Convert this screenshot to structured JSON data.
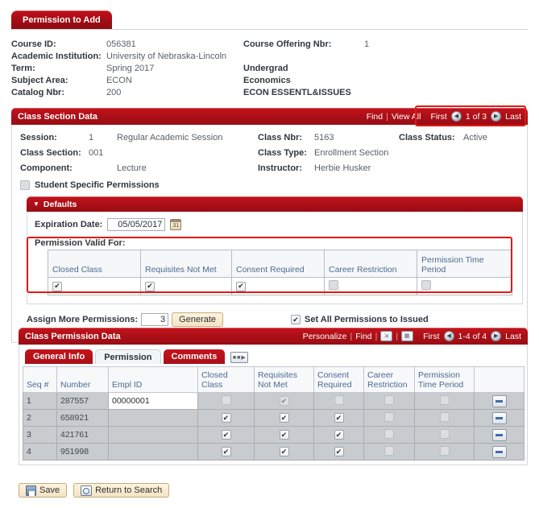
{
  "page_tab": {
    "label": "Permission to Add"
  },
  "header": {
    "rows": [
      {
        "label": "Course ID:",
        "value": "056381",
        "label2": "Course Offering Nbr:",
        "value2": "1"
      },
      {
        "label": "Academic Institution:",
        "value": "University of Nebraska-Lincoln",
        "label2": "",
        "value2": ""
      },
      {
        "label": "Term:",
        "value": "Spring 2017",
        "label2": "",
        "value2": "Undergrad"
      },
      {
        "label": "Subject Area:",
        "value": "ECON",
        "label2": "",
        "value2": "Economics"
      },
      {
        "label": "Catalog Nbr:",
        "value": "200",
        "label2": "",
        "value2": "ECON ESSENTL&ISSUES"
      }
    ]
  },
  "class_section_data": {
    "title": "Class Section Data",
    "find_label": "Find",
    "view_all_label": "View All",
    "first_label": "First",
    "last_label": "Last",
    "counter": "1 of 3",
    "prev_icon": "left-arrow-icon",
    "next_icon": "right-arrow-icon",
    "fields": {
      "session_label": "Session:",
      "session_nbr": "1",
      "session_desc": "Regular Academic Session",
      "class_nbr_label": "Class Nbr:",
      "class_nbr": "5163",
      "class_status_label": "Class Status:",
      "class_status": "Active",
      "class_section_label": "Class Section:",
      "class_section": "001",
      "class_type_label": "Class Type:",
      "class_type": "Enrollment Section",
      "component_label": "Component:",
      "component": "Lecture",
      "instructor_label": "Instructor:",
      "instructor": "Herbie Husker"
    },
    "student_specific": {
      "label": "Student Specific Permissions",
      "checked": false
    }
  },
  "defaults": {
    "title": "Defaults",
    "collapse_icon": "triangle-down-icon",
    "expiration_label": "Expiration Date:",
    "expiration_value": "05/05/2017",
    "calendar_icon": "calendar-icon",
    "permission_valid_for_label": "Permission Valid For:",
    "columns": [
      "Closed Class",
      "Requisites Not Met",
      "Consent Required",
      "Career Restriction",
      "Permission Time Period"
    ],
    "values": [
      true,
      true,
      true,
      false,
      false
    ],
    "assign_more_label": "Assign More Permissions:",
    "assign_more_value": "3",
    "generate_label": "Generate",
    "set_all_label": "Set All Permissions to Issued",
    "set_all_checked": true
  },
  "class_permission_data": {
    "title": "Class Permission Data",
    "personalize_label": "Personalize",
    "find_label": "Find",
    "view_all_icon": "view-all-icon",
    "download_icon": "download-spreadsheet-icon",
    "first_label": "First",
    "last_label": "Last",
    "counter": "1-4 of 4",
    "prev_icon": "left-arrow-icon",
    "next_icon": "right-arrow-icon",
    "tabs": [
      {
        "label": "General Info",
        "active": false
      },
      {
        "label": "Permission",
        "active": true
      },
      {
        "label": "Comments",
        "active": false
      }
    ],
    "expand_icon": "expand-all-columns-icon",
    "columns": [
      "Seq #",
      "Number",
      "Empl ID",
      "Closed Class",
      "Requisites Not Met",
      "Consent Required",
      "Career Restriction",
      "Permission Time Period",
      ""
    ],
    "rows": [
      {
        "seq": "1",
        "number": "287557",
        "empl_id": "00000001",
        "closed_class": false,
        "requisites_not_met": true,
        "consent_required": false,
        "career_restriction": false,
        "permission_time_period": false,
        "disabled": true,
        "delete_icon": "minus-icon"
      },
      {
        "seq": "2",
        "number": "658921",
        "empl_id": "",
        "closed_class": true,
        "requisites_not_met": true,
        "consent_required": true,
        "career_restriction": false,
        "permission_time_period": false,
        "disabled": false,
        "delete_icon": "minus-icon"
      },
      {
        "seq": "3",
        "number": "421761",
        "empl_id": "",
        "closed_class": true,
        "requisites_not_met": true,
        "consent_required": true,
        "career_restriction": false,
        "permission_time_period": false,
        "disabled": false,
        "delete_icon": "minus-icon"
      },
      {
        "seq": "4",
        "number": "951998",
        "empl_id": "",
        "closed_class": true,
        "requisites_not_met": true,
        "consent_required": true,
        "career_restriction": false,
        "permission_time_period": false,
        "disabled": false,
        "delete_icon": "minus-icon"
      }
    ]
  },
  "footer": {
    "save_label": "Save",
    "save_icon": "save-icon",
    "return_label": "Return to Search",
    "return_icon": "search-icon"
  },
  "colors": {
    "header_red": "#ac0f17",
    "annotation_red": "#e01a13",
    "column_header_text": "#4a6b92",
    "row_grey": "#c9cccf",
    "button_tan": "#f4e4c3"
  }
}
